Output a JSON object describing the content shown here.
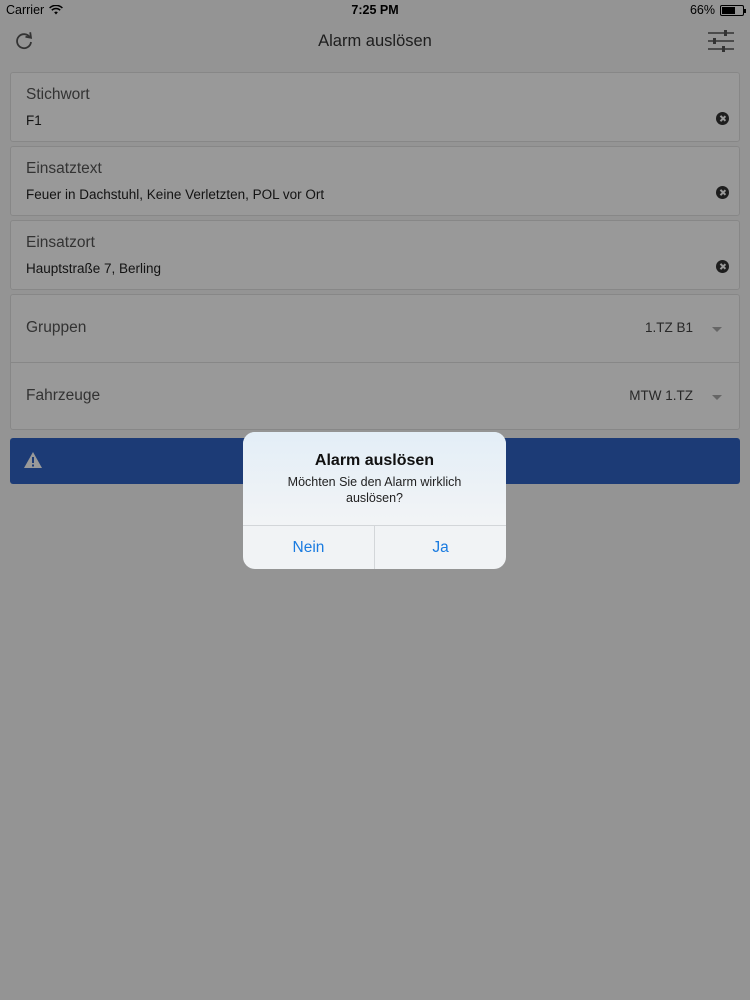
{
  "status_bar": {
    "carrier": "Carrier",
    "time": "7:25 PM",
    "battery": "66%",
    "battery_level": 0.66
  },
  "nav": {
    "title": "Alarm auslösen",
    "left_icon": "refresh-icon",
    "right_icon": "settings-sliders-icon"
  },
  "form": {
    "stichwort": {
      "label": "Stichwort",
      "value": "F1"
    },
    "einsatztext": {
      "label": "Einsatztext",
      "value": "Feuer in Dachstuhl, Keine Verletzten, POL vor Ort"
    },
    "einsatzort": {
      "label": "Einsatzort",
      "value": "Hauptstraße 7, Berling"
    },
    "gruppen": {
      "label": "Gruppen",
      "value": "1.TZ B1"
    },
    "fahrzeuge": {
      "label": "Fahrzeuge",
      "value": "MTW 1.TZ"
    }
  },
  "alarm_button": {
    "icon": "warning-icon",
    "color": "#2f63c5"
  },
  "alert": {
    "title": "Alarm auslösen",
    "message": "Möchten Sie den Alarm wirklich auslösen?",
    "cancel_label": "Nein",
    "confirm_label": "Ja",
    "button_color": "#1a7be0"
  }
}
